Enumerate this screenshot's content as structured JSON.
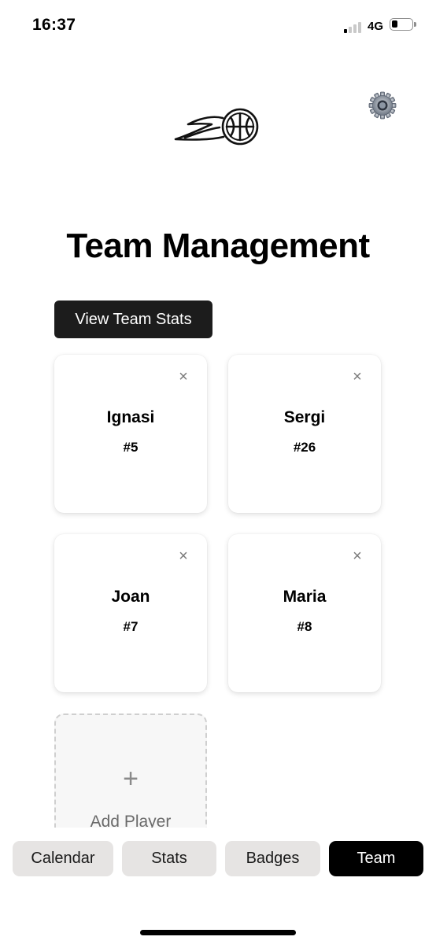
{
  "status_bar": {
    "time": "16:37",
    "network": "4G",
    "signal_bars_active": 1,
    "battery_level": 0.25
  },
  "header": {
    "logo_icon": "basketball-fireball-icon",
    "settings_icon": "gear-icon"
  },
  "page": {
    "title": "Team Management"
  },
  "actions": {
    "view_stats_label": "View Team Stats"
  },
  "players": [
    {
      "name": "Ignasi",
      "number": "#5",
      "remove_symbol": "×"
    },
    {
      "name": "Sergi",
      "number": "#26",
      "remove_symbol": "×"
    },
    {
      "name": "Joan",
      "number": "#7",
      "remove_symbol": "×"
    },
    {
      "name": "Maria",
      "number": "#8",
      "remove_symbol": "×"
    }
  ],
  "add_player": {
    "symbol": "+",
    "label": "Add Player"
  },
  "nav": {
    "items": [
      {
        "label": "Calendar",
        "active": false
      },
      {
        "label": "Stats",
        "active": false
      },
      {
        "label": "Badges",
        "active": false
      },
      {
        "label": "Team",
        "active": true
      }
    ]
  },
  "colors": {
    "accent": "#000000",
    "primary_button": "#1c1c1c",
    "nav_inactive": "#e6e4e3"
  }
}
